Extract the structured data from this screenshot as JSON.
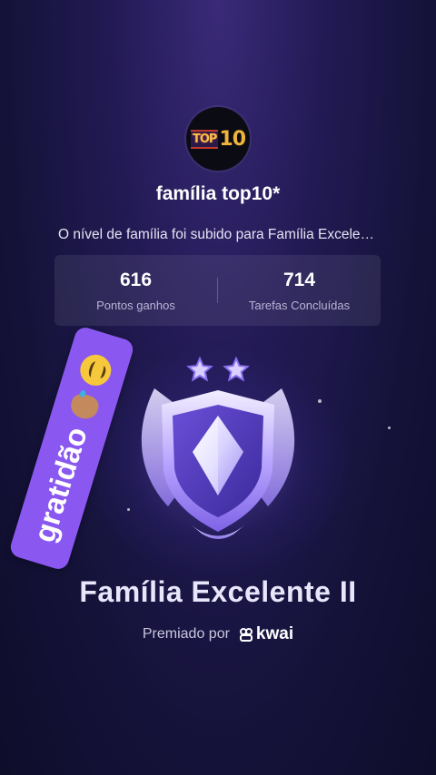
{
  "family": {
    "name": "família top10*",
    "logo_text_small": "TOP",
    "logo_text_big": "10"
  },
  "message": "O nível de família foi subido para Família Excelente II",
  "stats": [
    {
      "value": "616",
      "label": "Pontos ganhos"
    },
    {
      "value": "714",
      "label": "Tarefas Concluídas"
    }
  ],
  "sticker": {
    "text": "gratidão"
  },
  "award": {
    "name": "Família Excelente II",
    "stars": 2,
    "awarded_by_label": "Premiado por",
    "brand": "kwai"
  },
  "colors": {
    "sticker_bg": "#8a58f0",
    "badge_accent": "#a890ff"
  }
}
